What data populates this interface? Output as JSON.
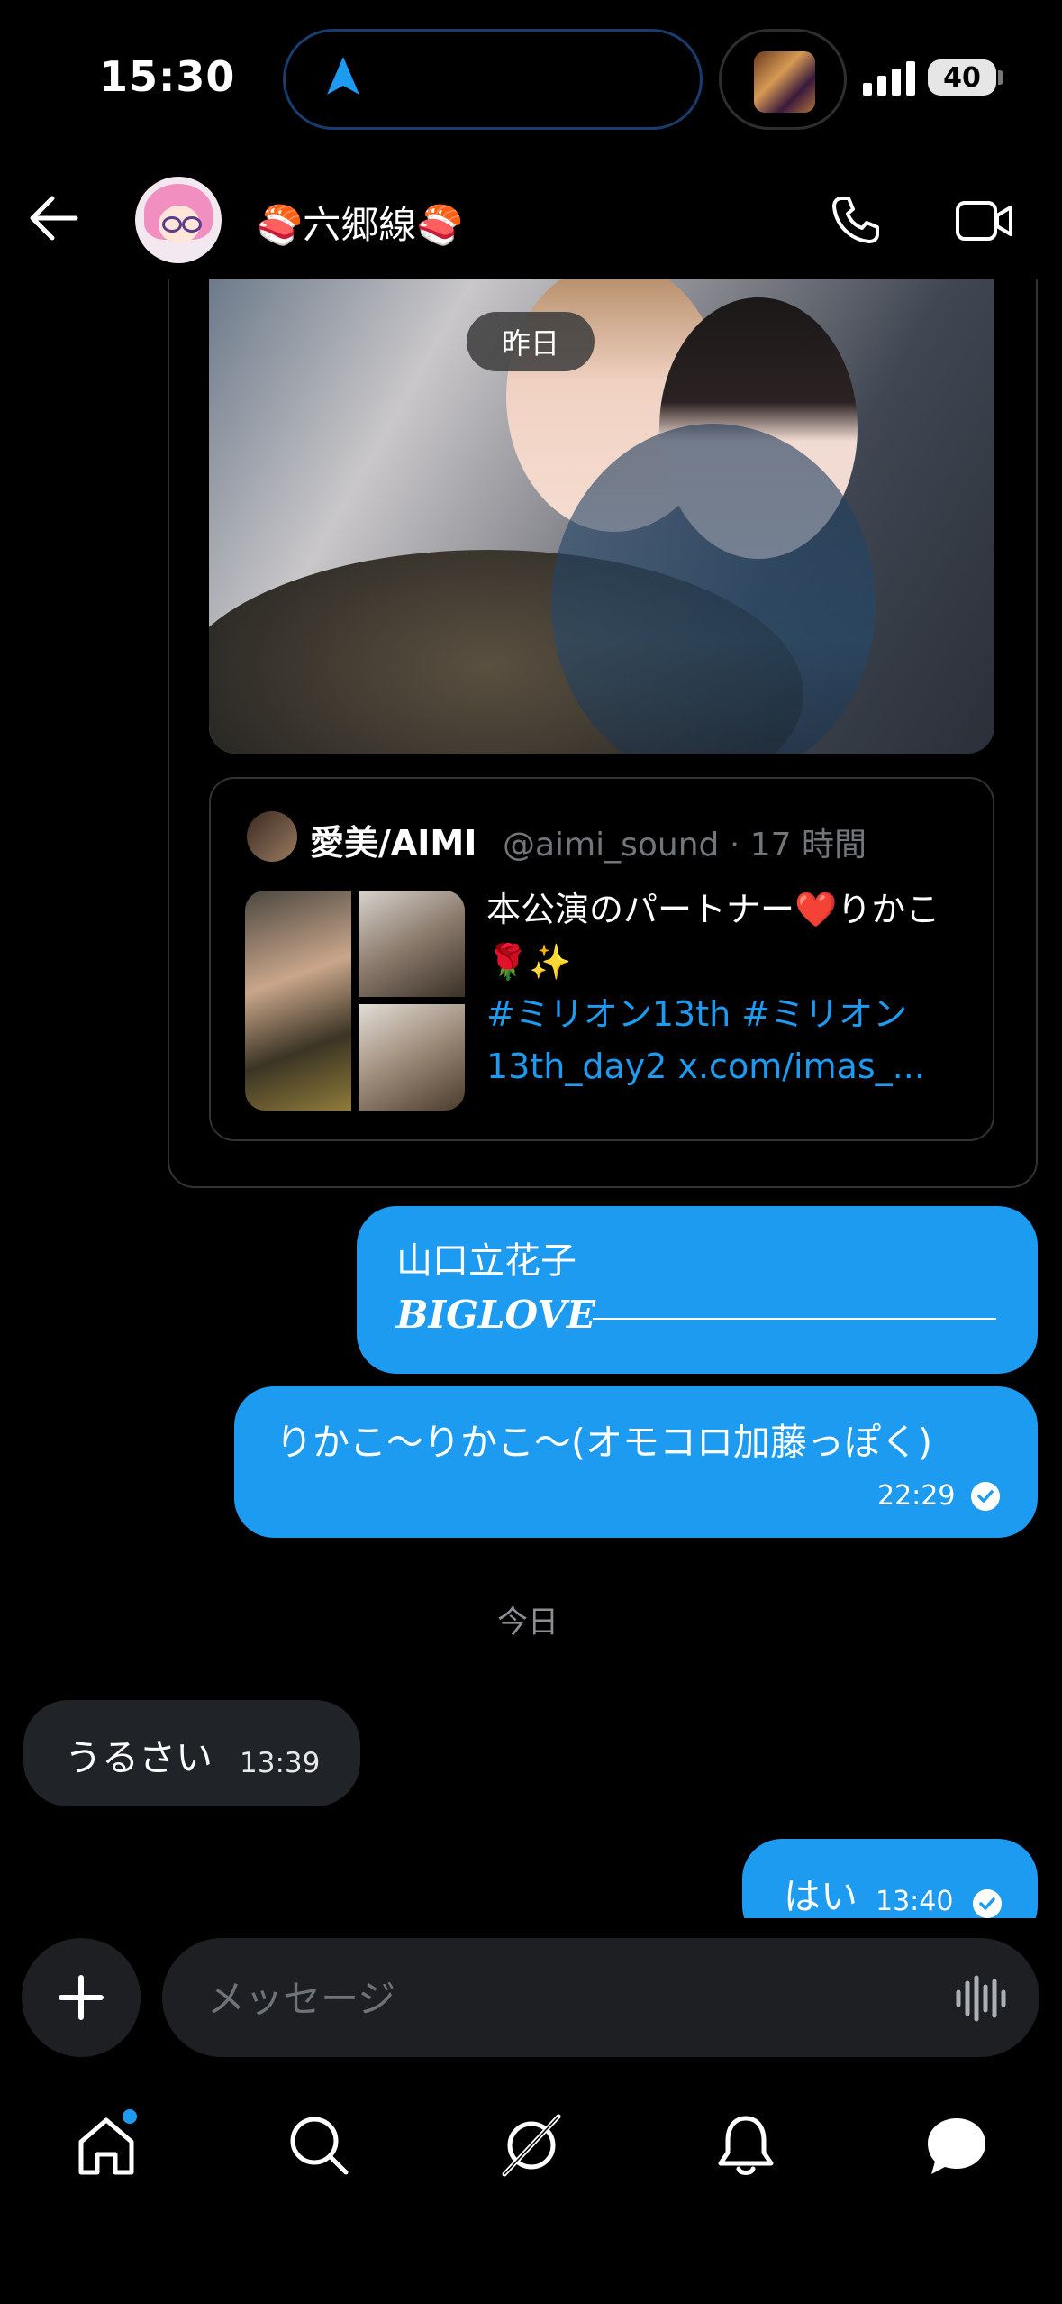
{
  "status_bar": {
    "time": "15:30",
    "battery": "40"
  },
  "header": {
    "chat_title": "🍣六郷線🍣"
  },
  "messages": {
    "date_pill_yesterday": "昨日",
    "quote_card": {
      "author_name": "愛美/AIMI",
      "author_handle": "@aimi_sound · 17 時間",
      "text": "本公演のパートナー❤️りかこ🌹✨",
      "tags": "#ミリオン13th #ミリオン13th_day2 x.com/imas_..."
    },
    "outgoing_1": {
      "line1": "山口立花子",
      "line2": "BIGLOVE"
    },
    "outgoing_2": {
      "text": "りかこ～りかこ～(オモコロ加藤っぽく)",
      "time": "22:29"
    },
    "date_today": "今日",
    "incoming_1": {
      "text": "うるさい",
      "time": "13:39"
    },
    "outgoing_3": {
      "text": "はい",
      "time": "13:40"
    }
  },
  "composer": {
    "placeholder": "メッセージ"
  },
  "tab_bar": {
    "items": [
      "home",
      "search",
      "grok",
      "notifications",
      "messages"
    ]
  },
  "colors": {
    "accent": "#1d9bf0",
    "incoming_bubble": "#202327",
    "background": "#000000"
  }
}
